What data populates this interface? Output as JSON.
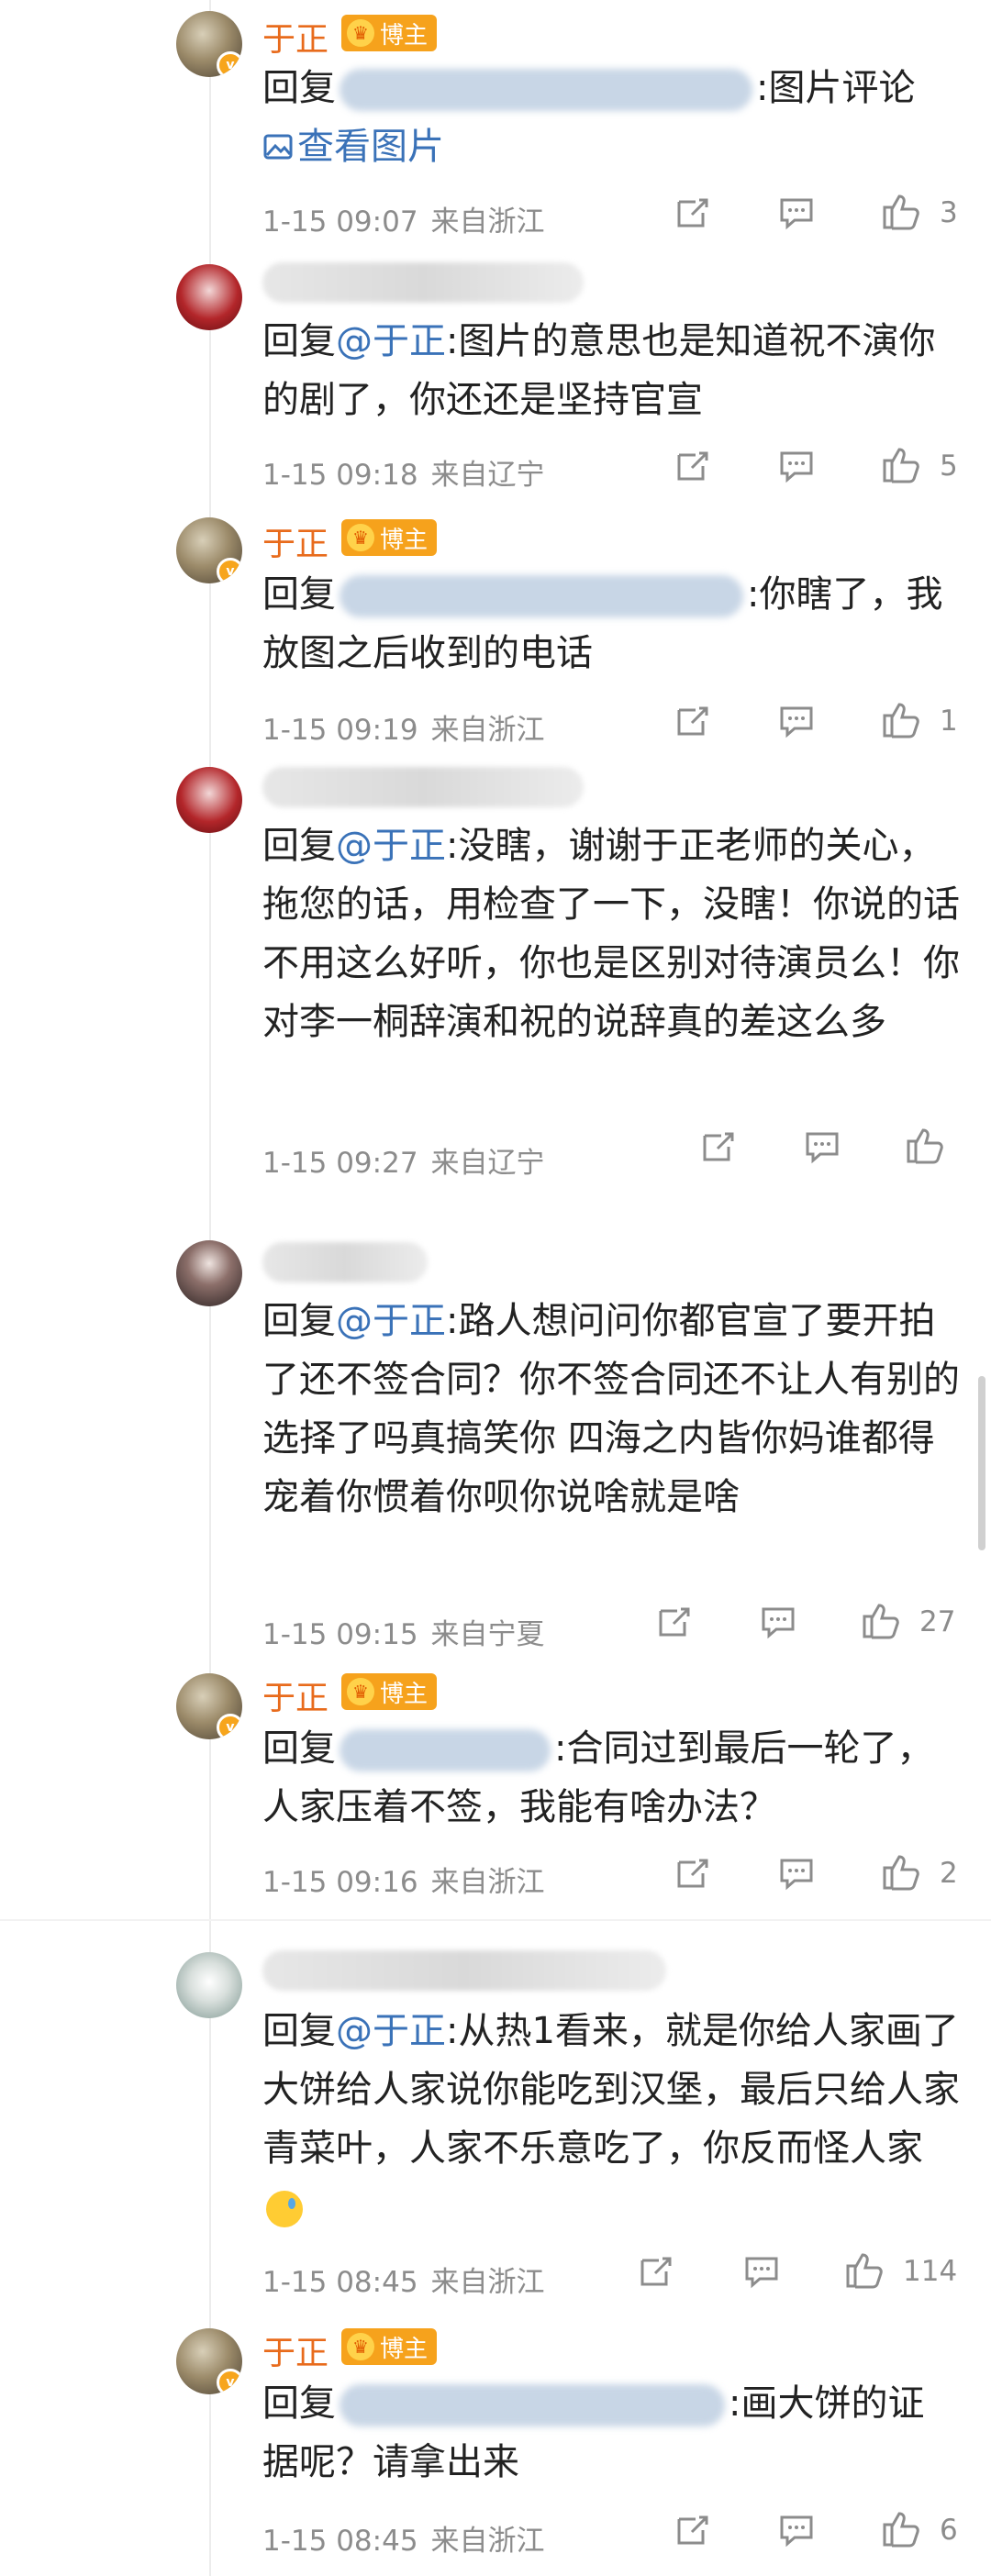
{
  "comments": [
    {
      "author": "于正",
      "host_badge": "博主",
      "reply_prefix": "回复",
      "reply_suffix": ":图片评论",
      "view_image": "查看图片",
      "time": "1-15 09:07",
      "location": "来自浙江",
      "likes": "3"
    },
    {
      "text_mention": "回复",
      "mention": "@于正",
      "text": ":图片的意思也是知道祝不演你的剧了，你还还是坚持官宣",
      "time": "1-15 09:18",
      "location": "来自辽宁",
      "likes": "5"
    },
    {
      "author": "于正",
      "host_badge": "博主",
      "reply_prefix": "回复",
      "reply_suffix": ":你瞎了，我放图之后收到的电话",
      "time": "1-15 09:19",
      "location": "来自浙江",
      "likes": "1"
    },
    {
      "text_mention": "回复",
      "mention": "@于正",
      "text": ":没瞎，谢谢于正老师的关心，拖您的话，用检查了一下，没瞎！你说的话不用这么好听，你也是区别对待演员么！你对李一桐辞演和祝的说辞真的差这么多",
      "time": "1-15 09:27",
      "location": "来自辽宁",
      "likes": ""
    },
    {
      "text_mention": "回复",
      "mention": "@于正",
      "text": ":路人想问问你都官宣了要开拍了还不签合同？你不签合同还不让人有别的选择了吗真搞笑你 四海之内皆你妈谁都得宠着你惯着你呗你说啥就是啥",
      "time": "1-15 09:15",
      "location": "来自宁夏",
      "likes": "27"
    },
    {
      "author": "于正",
      "host_badge": "博主",
      "reply_prefix": "回复",
      "reply_suffix": ":合同过到最后一轮了，人家压着不签，我能有啥办法？",
      "time": "1-15 09:16",
      "location": "来自浙江",
      "likes": "2"
    },
    {
      "text_mention": "回复",
      "mention": "@于正",
      "text": ":从热1看来，就是你给人家画了大饼给人家说你能吃到汉堡，最后只给人家青菜叶，人家不乐意吃了，你反而怪人家",
      "time": "1-15 08:45",
      "location": "来自浙江",
      "likes": "114"
    },
    {
      "author": "于正",
      "host_badge": "博主",
      "reply_prefix": "回复",
      "reply_suffix": ":画大饼的证据呢？请拿出来",
      "time": "1-15 08:45",
      "location": "来自浙江",
      "likes": "6"
    }
  ],
  "icons": {
    "repost": "repost-icon",
    "comment": "comment-icon",
    "like": "like-icon",
    "view_image": "image-icon"
  },
  "colors": {
    "author_name": "#e86b1c",
    "mention": "#3a72b8",
    "meta": "#8c8c8c",
    "badge": "#f6a21c"
  }
}
